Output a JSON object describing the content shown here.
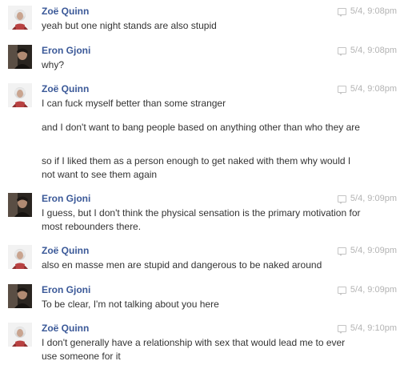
{
  "messages": [
    {
      "sender": "Zoë Quinn",
      "avatar": "zoe-avatar",
      "time": "5/4, 9:08pm",
      "lines": [
        "yeah but one night stands are also stupid"
      ]
    },
    {
      "sender": "Eron Gjoni",
      "avatar": "eron-avatar",
      "time": "5/4, 9:08pm",
      "lines": [
        "why?"
      ]
    },
    {
      "sender": "Zoë Quinn",
      "avatar": "zoe-avatar",
      "time": "5/4, 9:08pm",
      "lines": [
        "I can fuck myself better than some stranger",
        "and I don't want to bang people based on anything other than who they are",
        "so if I liked them as a person enough to get naked with them why would I not want to see them again"
      ]
    },
    {
      "sender": "Eron Gjoni",
      "avatar": "eron-avatar",
      "time": "5/4, 9:09pm",
      "lines": [
        "I guess, but I don't think the physical sensation is the primary motivation for most rebounders there."
      ]
    },
    {
      "sender": "Zoë Quinn",
      "avatar": "zoe-avatar",
      "time": "5/4, 9:09pm",
      "lines": [
        "also en masse men are stupid and dangerous to be naked around"
      ]
    },
    {
      "sender": "Eron Gjoni",
      "avatar": "eron-avatar",
      "time": "5/4, 9:09pm",
      "lines": [
        "To be clear, I'm not talking about you here"
      ]
    },
    {
      "sender": "Zoë Quinn",
      "avatar": "zoe-avatar",
      "time": "5/4, 9:10pm",
      "lines": [
        "I don't generally have a relationship with sex that would lead me to ever use someone for it"
      ]
    }
  ]
}
